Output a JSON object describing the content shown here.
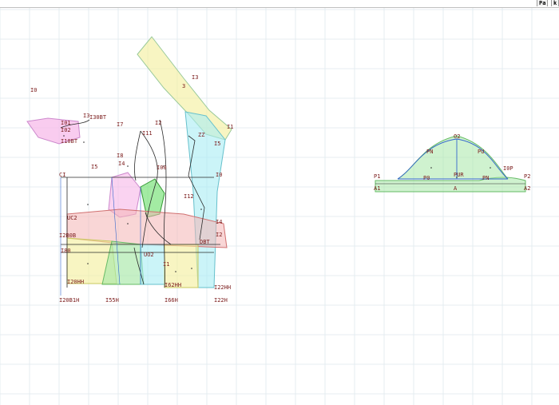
{
  "toolbar": {
    "btn1_label": "Pa",
    "btn2_label": "k"
  },
  "labels": {
    "l_I0": "I0",
    "l_I3": "I3",
    "l_I01": "I01",
    "l_I02": "I02",
    "l_I10BT": "I10BT",
    "l_I30BT": "I30BT",
    "l_I7": "I7",
    "l_I2": "I2",
    "l_I11": "I11",
    "l_I5": "I5",
    "l_I8": "I8",
    "l_I4": "I4",
    "l_I00": "I00",
    "l_CI": "CI",
    "l_UC2": "UC2",
    "l_I2B0B": "I2B0B",
    "l_I80": "I80",
    "l_I20HH": "I20HH",
    "l_I20B1H": "I20B1H",
    "l_I55H": "I55H",
    "l_I66H": "I66H",
    "l_I22H": "I22H",
    "l_I22HH": "I22HH",
    "l_I62HH": "I62HH",
    "l_I12": "I12",
    "l_I0r": "I0",
    "l_I4r": "I4",
    "l_I2r": "I2",
    "l_I1r": "I1",
    "l_I3r": "I3",
    "l_I5r": "I5",
    "l_3x": "3",
    "l_ZZ": "ZZ",
    "l_DBT": "DBT",
    "l_UO2": "UO2",
    "l_I1": "I1",
    "l_O2": "O2",
    "l_P1": "P1",
    "l_P2": "P2",
    "l_A1": "A1",
    "l_A2": "A2",
    "l_P0": "P0",
    "l_PN": "PN",
    "l_PU": "PU",
    "l_PUR": "PUR",
    "l_I0P": "I0P",
    "l_A": "A",
    "l_PNm": "PN",
    "l_PNr": "PN"
  },
  "colors": {
    "grid": "#dfe9ee",
    "yellow": "#f4ef9a",
    "green": "#a8e8a8",
    "cyan": "#a8ecf4",
    "pink": "#f6b6e8",
    "red": "#f4b4b4",
    "blue": "#3366cc",
    "outline": "#2a2a2a"
  }
}
